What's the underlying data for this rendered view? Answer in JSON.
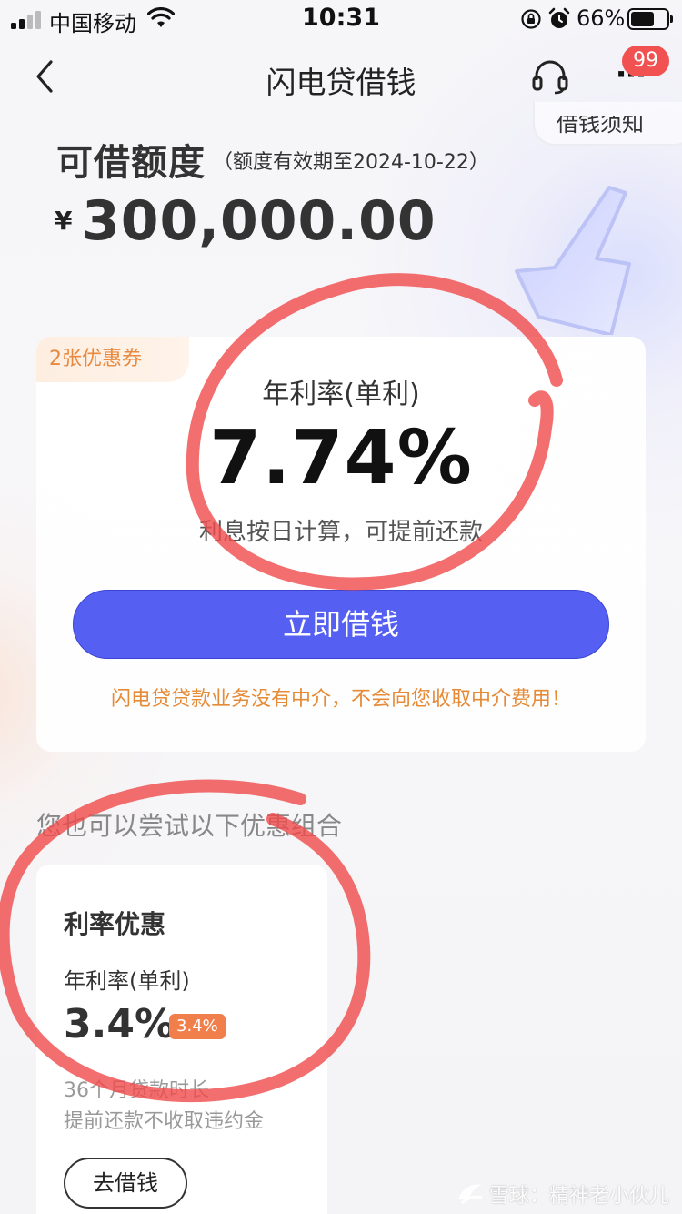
{
  "status_bar": {
    "carrier": "中国移动",
    "time": "10:31",
    "battery_percent_text": "66%",
    "battery_level": 0.66
  },
  "nav": {
    "title": "闪电贷借钱",
    "more_badge": "99",
    "notice_tab": "借钱须知"
  },
  "quota": {
    "title": "可借额度",
    "validity": "（额度有效期至2024-10-22）",
    "currency": "¥",
    "amount": "300,000.00"
  },
  "rate_card": {
    "coupon_tag": "2张优惠券",
    "rate_label": "年利率(单利)",
    "rate_value": "7.74%",
    "rate_note": "利息按日计算，可提前还款",
    "borrow_button": "立即借钱",
    "disclaimer": "闪电贷贷款业务没有中介，不会向您收取中介费用！"
  },
  "combos": {
    "heading": "您也可以尝试以下优惠组合",
    "items": [
      {
        "title": "利率优惠",
        "rate_label": "年利率(单利)",
        "rate": "3.4%",
        "badge": "3.4%",
        "term": "36个月贷款时长",
        "prepay": "提前还款不收取违约金",
        "button": "去借钱"
      }
    ]
  },
  "watermark": {
    "text": "雪球：精神老小伙儿"
  },
  "colors": {
    "primary_button": "#5560f2",
    "coupon_text": "#e8893f",
    "disclaimer_text": "#e58a36",
    "badge_red": "#f25151",
    "combo_badge": "#f07f4c",
    "annotation_red": "#f04a4a"
  },
  "icons": {
    "back": "chevron-left-icon",
    "service": "headset-icon",
    "more": "more-dots-icon",
    "signal": "signal-icon",
    "wifi": "wifi-icon",
    "lock": "rotation-lock-icon",
    "alarm": "alarm-icon",
    "battery": "battery-icon",
    "illustration": "lightning-icon",
    "watermark_logo": "snowball-logo-icon"
  }
}
